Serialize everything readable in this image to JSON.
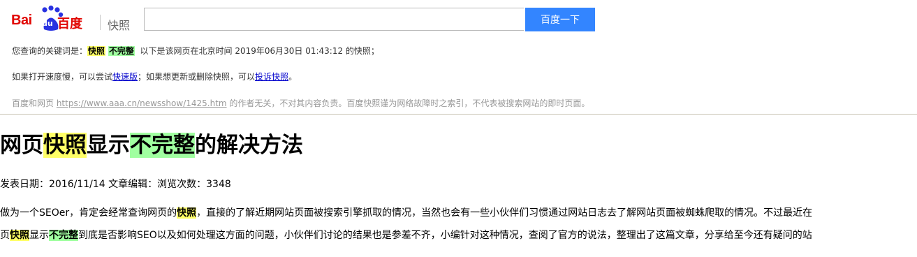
{
  "header": {
    "logo": {
      "part1": "Bai",
      "part2": "du",
      "part3": "百度",
      "product": "快照"
    },
    "search": {
      "value": "",
      "button_label": "百度一下"
    }
  },
  "notice": {
    "keywords_prefix": "您查询的关键词是：",
    "keyword1": "快照",
    "keyword2": "不完整",
    "suffix": "以下是该网页在北京时间 2019年06月30日 01:43:12 的快照；",
    "line2_a": "如果打开速度慢，可以尝试",
    "fast_link": "快速版",
    "line2_b": "；如果想更新或删除快照，可以",
    "complain_link": "投诉快照",
    "line2_c": "。",
    "line3_a": "百度和网页 ",
    "source_url": "https://www.aaa.cn/newsshow/1425.htm",
    "line3_b": " 的作者无关，不对其内容负责。百度快照谨为网络故障时之索引，不代表被搜索网站的即时页面。"
  },
  "article": {
    "title_a": "网页",
    "title_hl1": "快照",
    "title_b": "显示",
    "title_hl2": "不完整",
    "title_c": "的解决方法",
    "meta": "发表日期：2016/11/14 文章编辑：浏览次数：3348",
    "p1_a": "做为一个SEOer，肯定会经常查询网页的",
    "p1_hl": "快照",
    "p1_b": "，直接的了解近期网站页面被搜索引擎抓取的情况，当然也会有一些小伙伴们习惯通过网站日志去了解网站页面被蜘蛛爬取的情况。不过最近在",
    "p2_a": "页",
    "p2_hl1": "快照",
    "p2_b": "显示",
    "p2_hl2": "不完整",
    "p2_c": "到底是否影响SEO以及如何处理这方面的问题，小伙伴们讨论的结果也是参差不齐，小编针对这种情况，查阅了官方的说法，整理出了这篇文章，分享给至今还有疑问的站"
  },
  "colors": {
    "brand_red": "#e10602",
    "brand_blue": "#2932e1",
    "button_blue": "#3385ff",
    "highlight_yellow": "#ffff66",
    "highlight_green": "#a0ffa0"
  }
}
